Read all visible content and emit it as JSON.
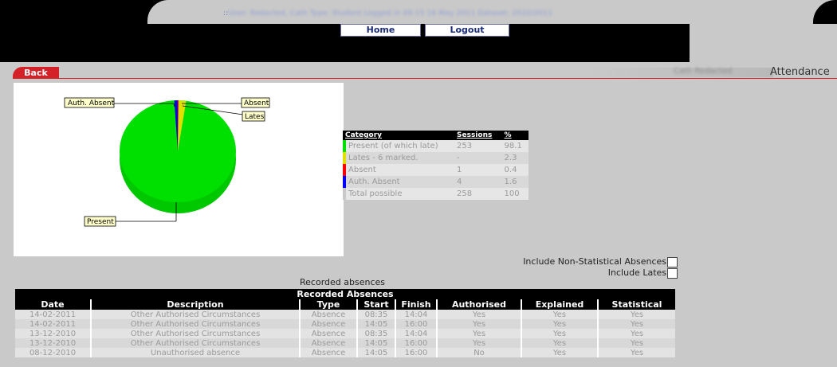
{
  "header": {
    "userinfo_prefix": "::",
    "userinfo_blurred": "User: Redacted, Cath    Type: Student    Logged in 09:15 16 May 2011    Dataset: 2010/2011",
    "nav": [
      {
        "label": "Home"
      },
      {
        "label": "Logout"
      }
    ]
  },
  "subheader": {
    "back_label": "Back",
    "student_name": "Cath Redacted",
    "page_heading": "Attendance"
  },
  "pie": {
    "labels": {
      "auth_absent": "Auth. Absent",
      "absent": "Absent",
      "lates": "Lates",
      "present": "Present"
    }
  },
  "summary": {
    "headers": [
      "Category",
      "Sessions",
      "%"
    ],
    "rows": [
      {
        "category": "Present (of which late)",
        "sessions": "253",
        "pct": "98.1",
        "color": "#00e000"
      },
      {
        "category": "Lates - 6 marked.",
        "sessions": "-",
        "pct": "2.3",
        "color": "#e0e000"
      },
      {
        "category": "Absent",
        "sessions": "1",
        "pct": "0.4",
        "color": "#ff0000"
      },
      {
        "category": "Auth. Absent",
        "sessions": "4",
        "pct": "1.6",
        "color": "#0000ff"
      },
      {
        "category": "Total possible",
        "sessions": "258",
        "pct": "100",
        "color": ""
      }
    ]
  },
  "options": {
    "non_statistical_label": "Include Non-Statistical Absences",
    "lates_label": "Include Lates",
    "non_statistical_checked": false,
    "lates_checked": false
  },
  "absences": {
    "label": "Recorded absences",
    "caption": "Recorded Absences",
    "headers": [
      "Date",
      "Description",
      "Type",
      "Start",
      "Finish",
      "Authorised",
      "Explained",
      "Statistical"
    ],
    "rows": [
      [
        "14-02-2011",
        "Other Authorised Circumstances",
        "Absence",
        "08:35",
        "14:04",
        "Yes",
        "Yes",
        "Yes"
      ],
      [
        "14-02-2011",
        "Other Authorised Circumstances",
        "Absence",
        "14:05",
        "16:00",
        "Yes",
        "Yes",
        "Yes"
      ],
      [
        "13-12-2010",
        "Other Authorised Circumstances",
        "Absence",
        "08:35",
        "14:04",
        "Yes",
        "Yes",
        "Yes"
      ],
      [
        "13-12-2010",
        "Other Authorised Circumstances",
        "Absence",
        "14:05",
        "16:00",
        "Yes",
        "Yes",
        "Yes"
      ],
      [
        "08-12-2010",
        "Unauthorised absence",
        "Absence",
        "14:05",
        "16:00",
        "No",
        "Yes",
        "Yes"
      ]
    ]
  }
}
